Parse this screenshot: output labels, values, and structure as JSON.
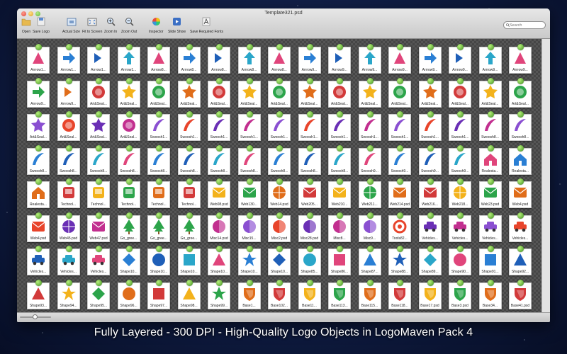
{
  "window": {
    "title": "Template321.psd"
  },
  "toolbar": {
    "items": [
      {
        "id": "open",
        "label": "Open",
        "icon": "folder-icon"
      },
      {
        "id": "save-logo",
        "label": "Save Logo",
        "icon": "save-icon"
      },
      {
        "id": "actual-size",
        "label": "Actual Size",
        "icon": "actual-size-icon"
      },
      {
        "id": "fit-to-screen",
        "label": "Fit to Screen",
        "icon": "fit-screen-icon"
      },
      {
        "id": "zoom-in",
        "label": "Zoom In",
        "icon": "zoom-in-icon"
      },
      {
        "id": "zoom-out",
        "label": "Zoom Out",
        "icon": "zoom-out-icon"
      },
      {
        "id": "inspector",
        "label": "Inspector",
        "icon": "color-wheel-icon"
      },
      {
        "id": "slide-show",
        "label": "Slide Show",
        "icon": "play-icon"
      },
      {
        "id": "save-fonts",
        "label": "Save Required Fonts",
        "icon": "font-icon"
      }
    ]
  },
  "search": {
    "placeholder": "Search"
  },
  "colors": {
    "pin": "#4fa82a",
    "accent": "#2f6ec6"
  },
  "grid": {
    "rows": [
      [
        "Arrrow1...",
        "Arrrow1...",
        "Arrrow1...",
        "Arrrow1...",
        "Arrrow8...",
        "Arrrow8...",
        "Arrrow8...",
        "Arrrow8...",
        "Arrrow8...",
        "Arrrow9...",
        "Arrrow9...",
        "Arrrow9...",
        "Arrrow9...",
        "Arrrow9...",
        "Arrrow9...",
        "Arrrow9...",
        "Arrrow9..."
      ],
      [
        "Arrrow9...",
        "Arrrow9...",
        "Art&Seal...",
        "Art&Seal...",
        "Art&Seal...",
        "Art&Seal...",
        "Art&Seal...",
        "Art&Seal...",
        "Art&Seal...",
        "Art&Seal...",
        "Art&Seal...",
        "Art&Seal...",
        "Art&Seal...",
        "Art&Seal...",
        "Art&Seal...",
        "Art&Seal...",
        "Art&Seal..."
      ],
      [
        "Art&Seal...",
        "Art&Seal...",
        "Art&Seal...",
        "Art&Seal...",
        "Swoosh1...",
        "Swoosh1...",
        "Swoosh1...",
        "Swoosh1...",
        "Swoosh1...",
        "Swoosh1...",
        "Swoosh1...",
        "Swoosh1...",
        "Swoosh1...",
        "Swoosh1...",
        "Swoosh1...",
        "Swoosh8...",
        "Swoosh8..."
      ],
      [
        "Swoosh8...",
        "Swoosh8...",
        "Swoosh8...",
        "Swoosh8...",
        "Swoosh8...",
        "Swoosh8...",
        "Swoosh8...",
        "Swoosh8...",
        "Swoosh8...",
        "Swoosh8...",
        "Swoosh8...",
        "Swoosh9...",
        "Swoosh9...",
        "Swoosh9...",
        "Swoosh9...",
        "Realesta...",
        "Realesta..."
      ],
      [
        "Realesta...",
        "Technol...",
        "Technol...",
        "Technol...",
        "Technol...",
        "Technol...",
        "Web08.psd",
        "Web130...",
        "Web14.psd",
        "Web205...",
        "Web210...",
        "Web211...",
        "Web214.psd",
        "Web216...",
        "Web218...",
        "Web23.psd",
        "Web4.psd"
      ],
      [
        "Web4.psd",
        "Web45.psd",
        "Web47.psd",
        "Go_gree...",
        "Go_gree...",
        "Go_gree...",
        "Misc14.psd",
        "Misc15...",
        "Misc2.psd",
        "Misc28.psd",
        "Misc8...",
        "Misc9...",
        "Tools82...",
        "Vehicles...",
        "Vehicles...",
        "Vehicles...",
        "Vehicles..."
      ],
      [
        "Vehicles...",
        "Vehicles...",
        "Vehicles...",
        "Shape10...",
        "Shape10...",
        "Shape10...",
        "Shape10...",
        "Shape10...",
        "Shape10...",
        "Shape85...",
        "Shape86...",
        "Shape87...",
        "Shape88...",
        "Shape89...",
        "Shape90...",
        "Shape91...",
        "Shape92..."
      ],
      [
        "Shape93...",
        "Shape94...",
        "Shape95...",
        "Shape96...",
        "Shape97...",
        "Shape98...",
        "Shape99...",
        "Base1...",
        "Base102...",
        "Base11...",
        "Base113...",
        "Base115...",
        "Base118...",
        "Base17.psd",
        "Base3.psd",
        "Base34...",
        "Base41.psd"
      ]
    ]
  }
}
